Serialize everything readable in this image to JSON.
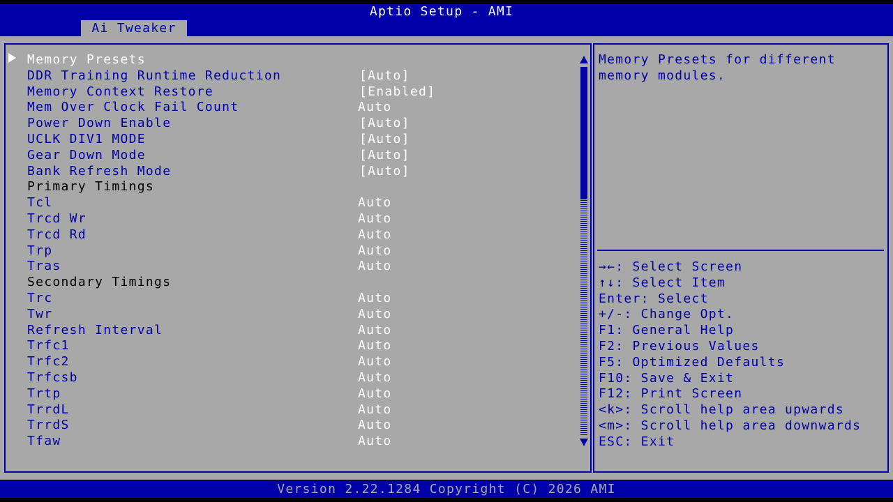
{
  "header": {
    "title": "Aptio Setup - AMI",
    "tab": "Ai Tweaker"
  },
  "settings": [
    {
      "label": "Memory Presets",
      "value": "",
      "kind": "selected"
    },
    {
      "label": "DDR Training Runtime Reduction",
      "value": "[Auto]",
      "kind": "item"
    },
    {
      "label": "Memory Context Restore",
      "value": "[Enabled]",
      "kind": "item"
    },
    {
      "label": "Mem Over Clock Fail Count",
      "value": "Auto",
      "kind": "item"
    },
    {
      "label": "Power Down Enable",
      "value": "[Auto]",
      "kind": "item"
    },
    {
      "label": "UCLK DIV1 MODE",
      "value": "[Auto]",
      "kind": "item"
    },
    {
      "label": "Gear Down Mode",
      "value": "[Auto]",
      "kind": "item"
    },
    {
      "label": "Bank Refresh Mode",
      "value": "[Auto]",
      "kind": "item"
    },
    {
      "label": "Primary Timings",
      "value": "",
      "kind": "header"
    },
    {
      "label": "Tcl",
      "value": "Auto",
      "kind": "item"
    },
    {
      "label": "Trcd Wr",
      "value": "Auto",
      "kind": "item"
    },
    {
      "label": "Trcd Rd",
      "value": "Auto",
      "kind": "item"
    },
    {
      "label": "Trp",
      "value": "Auto",
      "kind": "item"
    },
    {
      "label": "Tras",
      "value": "Auto",
      "kind": "item"
    },
    {
      "label": "Secondary Timings",
      "value": "",
      "kind": "header"
    },
    {
      "label": "Trc",
      "value": "Auto",
      "kind": "item"
    },
    {
      "label": "Twr",
      "value": "Auto",
      "kind": "item"
    },
    {
      "label": "Refresh Interval",
      "value": "Auto",
      "kind": "item"
    },
    {
      "label": "Trfc1",
      "value": "Auto",
      "kind": "item"
    },
    {
      "label": "Trfc2",
      "value": "Auto",
      "kind": "item"
    },
    {
      "label": "Trfcsb",
      "value": "Auto",
      "kind": "item"
    },
    {
      "label": "Trtp",
      "value": "Auto",
      "kind": "item"
    },
    {
      "label": "TrrdL",
      "value": "Auto",
      "kind": "item"
    },
    {
      "label": "TrrdS",
      "value": "Auto",
      "kind": "item"
    },
    {
      "label": "Tfaw",
      "value": "Auto",
      "kind": "item"
    }
  ],
  "help": {
    "text": "Memory Presets for different\nmemory modules."
  },
  "keys": [
    "→←: Select Screen",
    "↑↓: Select Item",
    "Enter: Select",
    "+/-: Change Opt.",
    "F1: General Help",
    "F2: Previous Values",
    "F5: Optimized Defaults",
    "F10: Save & Exit",
    "F12: Print Screen",
    "<k>: Scroll help area upwards",
    "<m>: Scroll help area downwards",
    "ESC: Exit"
  ],
  "scroll_position_fraction": 0.0,
  "scroll_visible_fraction": 0.36,
  "footer": {
    "text": "Version 2.22.1284 Copyright (C) 2026 AMI"
  },
  "colors": {
    "bios_blue": "#0000a8",
    "panel_gray": "#a8a8a8",
    "highlight_white": "#ffffff"
  }
}
